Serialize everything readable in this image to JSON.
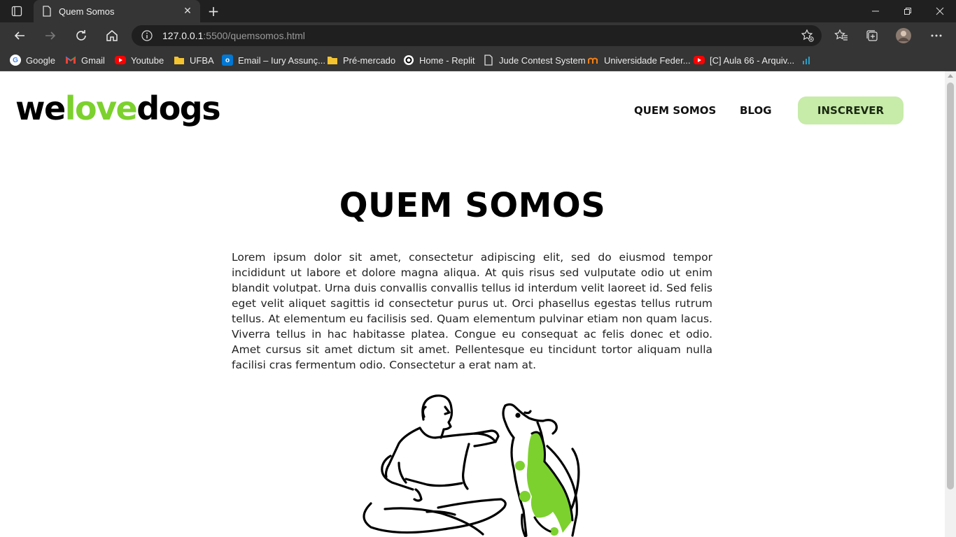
{
  "browser": {
    "tab_title": "Quem Somos",
    "url_host": "127.0.0.1",
    "url_path": ":5500/quemsomos.html",
    "bookmarks": [
      {
        "label": "Google",
        "icon": "google-icon",
        "color": "#4285f4"
      },
      {
        "label": "Gmail",
        "icon": "gmail-icon",
        "color": "#ea4335"
      },
      {
        "label": "Youtube",
        "icon": "youtube-icon",
        "color": "#ff0000"
      },
      {
        "label": "UFBA",
        "icon": "folder-icon",
        "color": "#f4c430"
      },
      {
        "label": "Email – Iury Assunç...",
        "icon": "outlook-icon",
        "color": "#0078d4"
      },
      {
        "label": "Pré-mercado",
        "icon": "folder-icon",
        "color": "#f4c430"
      },
      {
        "label": "Home - Replit",
        "icon": "replit-icon",
        "color": "#ffffff"
      },
      {
        "label": "Jude Contest System",
        "icon": "page-icon",
        "color": "#dddddd"
      },
      {
        "label": "Universidade Feder...",
        "icon": "moodle-icon",
        "color": "#f98012"
      },
      {
        "label": "[C] Aula 66 - Arquiv...",
        "icon": "youtube-icon",
        "color": "#ff0000"
      }
    ]
  },
  "site": {
    "logo": {
      "part1": "we",
      "part2": "love",
      "part3": "dogs"
    },
    "nav": {
      "about": "QUEM SOMOS",
      "blog": "BLOG",
      "subscribe": "INSCREVER"
    },
    "heading": "QUEM SOMOS",
    "paragraph": "Lorem ipsum dolor sit amet, consectetur adipiscing elit, sed do eiusmod tempor incididunt ut labore et dolore magna aliqua. At quis risus sed vulputate odio ut enim blandit volutpat. Urna duis convallis convallis tellus id interdum velit laoreet id. Sed felis eget velit aliquet sagittis id consectetur purus ut. Orci phasellus egestas tellus rutrum tellus. At elementum eu facilisis sed. Quam elementum pulvinar etiam non quam lacus. Viverra tellus in hac habitasse platea. Congue eu consequat ac felis donec et odio. Amet cursus sit amet dictum sit amet. Pellentesque eu tincidunt tortor aliquam nulla facilisi cras fermentum odio. Consectetur a erat nam at.",
    "accent_color": "#7cd12e",
    "button_color": "#c7eba9"
  }
}
